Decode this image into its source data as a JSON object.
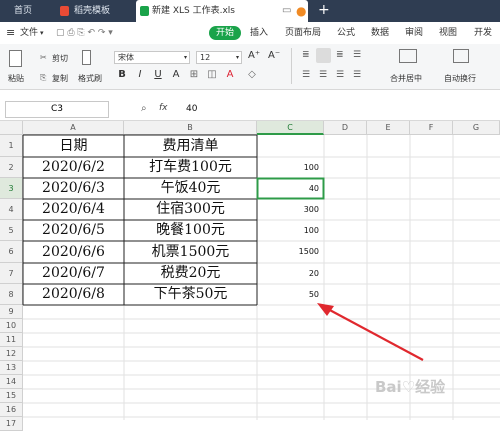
{
  "tabs": [
    {
      "label": "首页"
    },
    {
      "label": "稻壳模板"
    },
    {
      "label": "新建 XLS 工作表.xls"
    }
  ],
  "menu": {
    "file": "文件",
    "start": "开始",
    "items": [
      "插入",
      "页面布局",
      "公式",
      "数据",
      "审阅",
      "视图",
      "开发"
    ]
  },
  "ribbon": {
    "paste": "粘贴",
    "cut": "剪切",
    "copy": "复制",
    "format_painter": "格式刷",
    "font": "宋体",
    "size": "12",
    "merge": "合并居中",
    "wrap": "自动换行",
    "bold": "B",
    "italic": "I",
    "underline": "U",
    "font_a": "A"
  },
  "formula": {
    "name_box": "C3",
    "fx": "fx",
    "value": "40"
  },
  "columns": [
    "A",
    "B",
    "C",
    "D",
    "E",
    "F",
    "G"
  ],
  "rows": [
    "1",
    "2",
    "3",
    "4",
    "5",
    "6",
    "7",
    "8",
    "9",
    "10",
    "11",
    "12",
    "13",
    "14",
    "15",
    "16",
    "17"
  ],
  "table": {
    "header": {
      "date": "日期",
      "item": "费用清单"
    },
    "rows": [
      {
        "date": "2020/6/2",
        "item": "打车费100元",
        "amount": "100"
      },
      {
        "date": "2020/6/3",
        "item": "午饭40元",
        "amount": "40"
      },
      {
        "date": "2020/6/4",
        "item": "住宿300元",
        "amount": "300"
      },
      {
        "date": "2020/6/5",
        "item": "晚餐100元",
        "amount": "100"
      },
      {
        "date": "2020/6/6",
        "item": "机票1500元",
        "amount": "1500"
      },
      {
        "date": "2020/6/7",
        "item": "税费20元",
        "amount": "20"
      },
      {
        "date": "2020/6/8",
        "item": "下午茶50元",
        "amount": "50"
      }
    ]
  },
  "colors": {
    "accent": "#1aa34a",
    "arrow": "#e0282e",
    "titlebar": "#2f3d52"
  }
}
